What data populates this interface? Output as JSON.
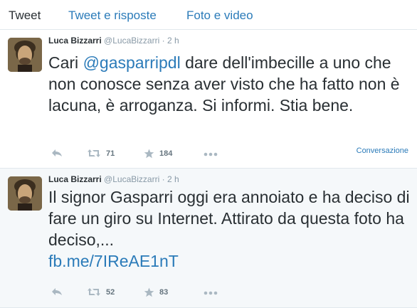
{
  "tabs": [
    {
      "label": "Tweet"
    },
    {
      "label": "Tweet e risposte"
    },
    {
      "label": "Foto e video"
    }
  ],
  "tweets": [
    {
      "name": "Luca Bizzarri",
      "handle": "@LucaBizzarri",
      "separator": "·",
      "time": "2 h",
      "text_before": "Cari ",
      "mention": "@gasparripdl",
      "text_after": " dare dell'imbecille a uno che non conosce senza aver visto che ha fatto non è lacuna, è arroganza. Si informi. Stia bene.",
      "retweets": "71",
      "favorites": "184",
      "conversation_label": "Conversazione"
    },
    {
      "name": "Luca Bizzarri",
      "handle": "@LucaBizzarri",
      "separator": "·",
      "time": "2 h",
      "text": "Il signor Gasparri oggi era annoiato e ha deciso di fare un giro su Internet. Attirato da questa foto ha deciso,...",
      "url": "fb.me/7IReAE1nT",
      "retweets": "52",
      "favorites": "83"
    }
  ],
  "colors": {
    "link": "#2b7bb9",
    "text": "#292f33",
    "muted": "#8899a6",
    "icon": "#aab8c2",
    "alt_background": "#f5f8fa"
  },
  "icons": [
    "reply-icon",
    "retweet-icon",
    "favorite-star-icon",
    "more-icon"
  ]
}
